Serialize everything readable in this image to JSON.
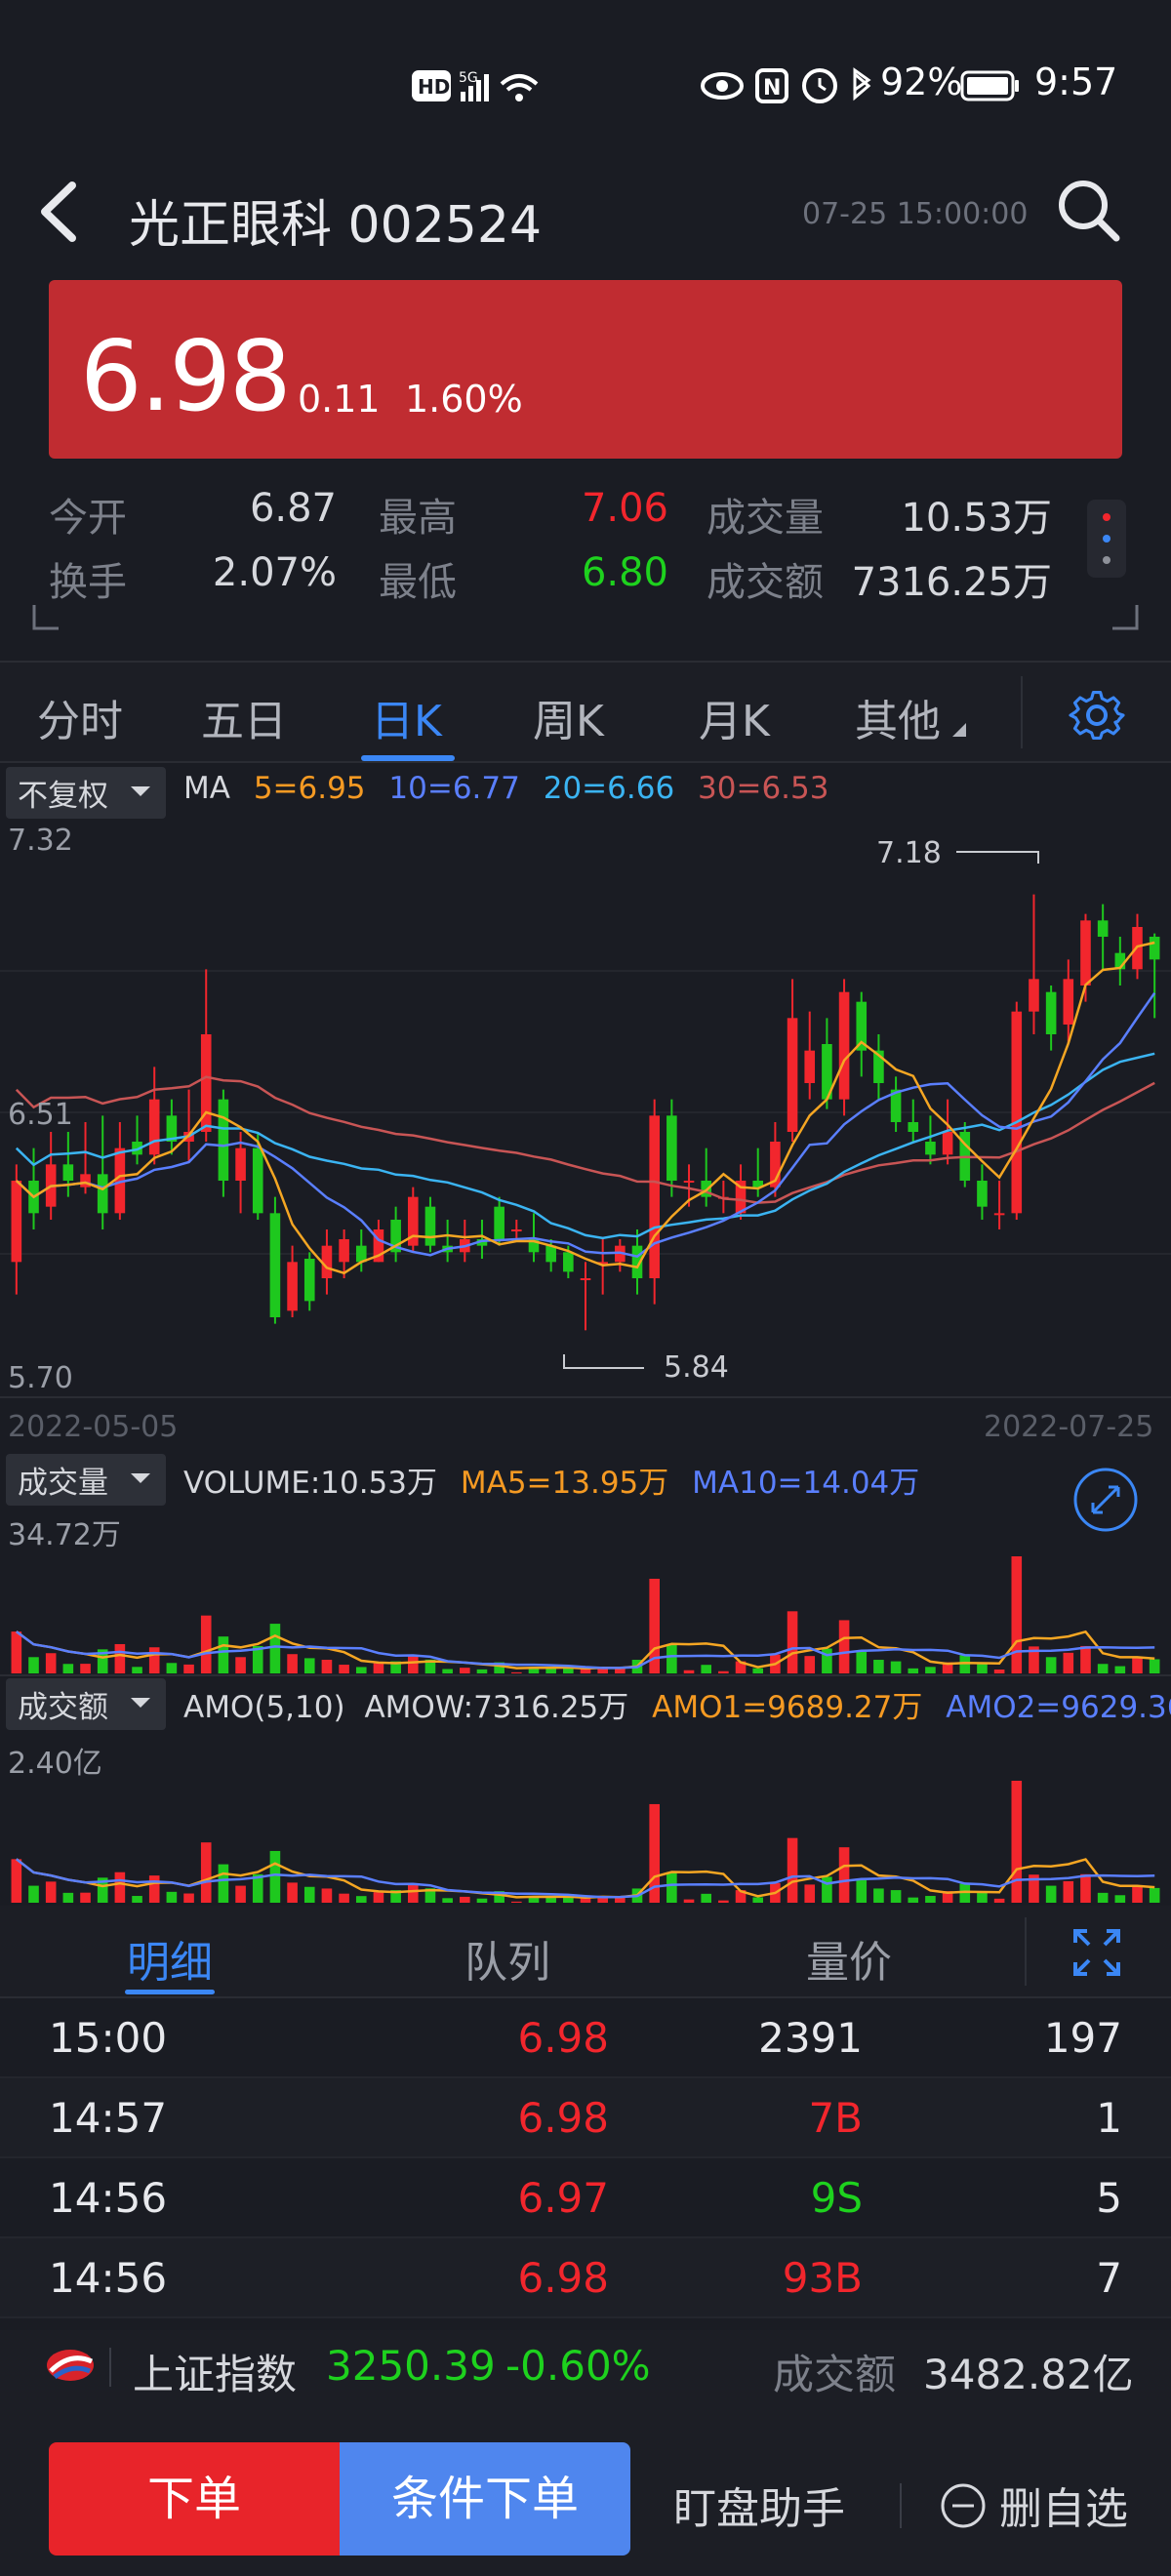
{
  "status_bar": {
    "battery": "92%",
    "time": "9:57"
  },
  "header": {
    "title": "光正眼科 002524",
    "timestamp": "07-25 15:00:00"
  },
  "price": {
    "current": "6.98",
    "change": "0.11",
    "change_pct": "1.60%"
  },
  "quote": {
    "open_label": "今开",
    "open": "6.87",
    "high_label": "最高",
    "high": "7.06",
    "volume_label": "成交量",
    "volume": "10.53万",
    "turnover_label": "换手",
    "turnover": "2.07%",
    "low_label": "最低",
    "low": "6.80",
    "amount_label": "成交额",
    "amount": "7316.25万"
  },
  "period_tabs": [
    "分时",
    "五日",
    "日K",
    "周K",
    "月K",
    "其他"
  ],
  "active_period": "日K",
  "kline": {
    "adjust_dropdown": "不复权",
    "ma_label": "MA",
    "ma5": "5=6.95",
    "ma10": "10=6.77",
    "ma20": "20=6.66",
    "ma30": "30=6.53",
    "y_top": "7.32",
    "y_mid": "6.51",
    "y_bottom": "5.70",
    "max_annotation": "7.18",
    "min_annotation": "5.84",
    "date_start": "2022-05-05",
    "date_end": "2022-07-25"
  },
  "volume_panel": {
    "dropdown": "成交量",
    "volume": "VOLUME:10.53万",
    "ma5": "MA5=13.95万",
    "ma10": "MA10=14.04万",
    "y_max": "34.72万"
  },
  "amount_panel": {
    "dropdown": "成交额",
    "amo_label": "AMO(5,10)",
    "amow": "AMOW:7316.25万",
    "amo1": "AMO1=9689.27万",
    "amo2": "AMO2=9629.36万",
    "y_max": "2.40亿"
  },
  "detail_tabs": [
    "明细",
    "队列",
    "量价"
  ],
  "trades": [
    {
      "time": "15:00",
      "price": "6.98",
      "vol": "2391",
      "count": "197",
      "vol_color": "white"
    },
    {
      "time": "14:57",
      "price": "6.98",
      "vol": "7B",
      "count": "1",
      "vol_color": "red"
    },
    {
      "time": "14:56",
      "price": "6.97",
      "vol": "9S",
      "count": "5",
      "vol_color": "green"
    },
    {
      "time": "14:56",
      "price": "6.98",
      "vol": "93B",
      "count": "7",
      "vol_color": "red"
    }
  ],
  "index_bar": {
    "name": "上证指数",
    "value": "3250.39",
    "change": "-0.60%",
    "amount_label": "成交额",
    "amount": "3482.82亿"
  },
  "bottom": {
    "order": "下单",
    "cond_order": "条件下单",
    "monitor": "盯盘助手",
    "remove_watch": "删自选"
  },
  "chart_data": {
    "type": "candlestick",
    "x_range": [
      "2022-05-05",
      "2022-07-25"
    ],
    "ylim": [
      5.7,
      7.32
    ],
    "candles": [
      [
        6.05,
        6.3,
        6.35,
        5.95
      ],
      [
        6.3,
        6.2,
        6.4,
        6.15
      ],
      [
        6.22,
        6.35,
        6.45,
        6.18
      ],
      [
        6.35,
        6.3,
        6.45,
        6.25
      ],
      [
        6.28,
        6.32,
        6.48,
        6.26
      ],
      [
        6.32,
        6.2,
        6.5,
        6.15
      ],
      [
        6.2,
        6.4,
        6.48,
        6.18
      ],
      [
        6.42,
        6.38,
        6.5,
        6.35
      ],
      [
        6.38,
        6.55,
        6.65,
        6.35
      ],
      [
        6.5,
        6.42,
        6.55,
        6.38
      ],
      [
        6.42,
        6.45,
        6.58,
        6.36
      ],
      [
        6.45,
        6.75,
        6.95,
        6.42
      ],
      [
        6.55,
        6.3,
        6.58,
        6.25
      ],
      [
        6.3,
        6.4,
        6.45,
        6.2
      ],
      [
        6.4,
        6.2,
        6.45,
        6.18
      ],
      [
        6.2,
        5.88,
        6.25,
        5.86
      ],
      [
        5.9,
        6.05,
        6.1,
        5.88
      ],
      [
        6.06,
        5.93,
        6.08,
        5.9
      ],
      [
        6.0,
        6.1,
        6.15,
        5.95
      ],
      [
        6.05,
        6.12,
        6.15,
        6.0
      ],
      [
        6.1,
        6.05,
        6.15,
        6.02
      ],
      [
        6.05,
        6.15,
        6.18,
        6.05
      ],
      [
        6.18,
        6.08,
        6.22,
        6.05
      ],
      [
        6.1,
        6.25,
        6.28,
        6.08
      ],
      [
        6.22,
        6.1,
        6.25,
        6.08
      ],
      [
        6.1,
        6.08,
        6.18,
        6.05
      ],
      [
        6.08,
        6.12,
        6.18,
        6.05
      ],
      [
        6.12,
        6.1,
        6.18,
        6.06
      ],
      [
        6.22,
        6.12,
        6.25,
        6.1
      ],
      [
        6.15,
        6.15,
        6.18,
        6.12
      ],
      [
        6.12,
        6.08,
        6.2,
        6.05
      ],
      [
        6.1,
        6.05,
        6.12,
        6.02
      ],
      [
        6.08,
        6.02,
        6.1,
        6.0
      ],
      [
        6.0,
        6.0,
        6.05,
        5.84
      ],
      [
        6.05,
        6.05,
        6.12,
        5.95
      ],
      [
        6.05,
        6.1,
        6.12,
        6.02
      ],
      [
        6.1,
        6.0,
        6.15,
        5.95
      ],
      [
        6.0,
        6.5,
        6.55,
        5.92
      ],
      [
        6.5,
        6.3,
        6.55,
        6.25
      ],
      [
        6.3,
        6.3,
        6.35,
        6.22
      ],
      [
        6.3,
        6.25,
        6.4,
        6.22
      ],
      [
        6.25,
        6.25,
        6.3,
        6.2
      ],
      [
        6.2,
        6.3,
        6.35,
        6.18
      ],
      [
        6.3,
        6.28,
        6.4,
        6.25
      ],
      [
        6.28,
        6.42,
        6.48,
        6.25
      ],
      [
        6.45,
        6.8,
        6.92,
        6.42
      ],
      [
        6.6,
        6.7,
        6.82,
        6.55
      ],
      [
        6.72,
        6.55,
        6.8,
        6.52
      ],
      [
        6.55,
        6.88,
        6.92,
        6.5
      ],
      [
        6.85,
        6.7,
        6.88,
        6.62
      ],
      [
        6.7,
        6.6,
        6.75,
        6.55
      ],
      [
        6.58,
        6.48,
        6.62,
        6.45
      ],
      [
        6.48,
        6.45,
        6.55,
        6.42
      ],
      [
        6.42,
        6.38,
        6.5,
        6.35
      ],
      [
        6.38,
        6.45,
        6.55,
        6.35
      ],
      [
        6.45,
        6.3,
        6.48,
        6.28
      ],
      [
        6.3,
        6.22,
        6.35,
        6.18
      ],
      [
        6.2,
        6.2,
        6.3,
        6.15
      ],
      [
        6.2,
        6.82,
        6.85,
        6.18
      ],
      [
        6.82,
        6.92,
        7.18,
        6.75
      ],
      [
        6.88,
        6.75,
        6.9,
        6.7
      ],
      [
        6.78,
        6.92,
        6.98,
        6.72
      ],
      [
        6.9,
        7.1,
        7.12,
        6.85
      ],
      [
        7.1,
        7.05,
        7.15,
        6.95
      ],
      [
        7.0,
        6.95,
        7.05,
        6.9
      ],
      [
        6.95,
        7.08,
        7.12,
        6.92
      ],
      [
        7.05,
        6.98,
        7.06,
        6.8
      ]
    ]
  }
}
